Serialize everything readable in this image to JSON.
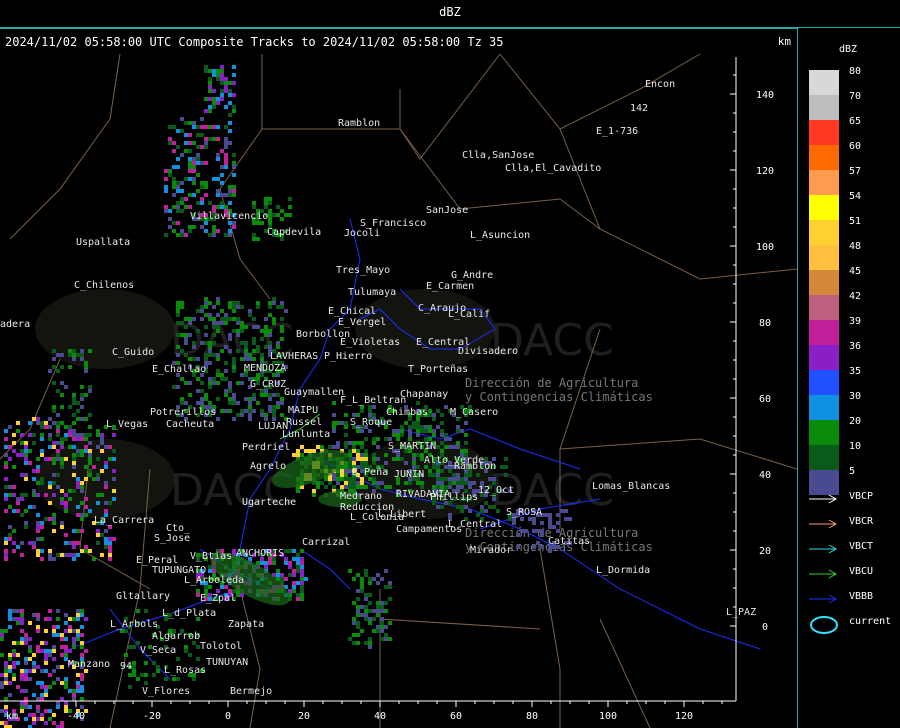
{
  "window": {
    "title": "dBZ"
  },
  "header": {
    "text": "2024/11/02 05:58:00 UTC Composite Tracks to 2024/11/02 05:58:00 Tz 35",
    "unit_top": "km"
  },
  "x_axis": {
    "unit": "km",
    "ticks": [
      "-40",
      "-20",
      "0",
      "20",
      "40",
      "60",
      "80",
      "100",
      "120"
    ]
  },
  "y_axis": {
    "ticks": [
      "140",
      "120",
      "100",
      "80",
      "60",
      "40",
      "20",
      "0"
    ]
  },
  "scale": {
    "unit": "dBZ",
    "levels": [
      {
        "label": "80",
        "color": "#d8d8d8"
      },
      {
        "label": "70",
        "color": "#bdbdbd"
      },
      {
        "label": "65",
        "color": "#ff3a20"
      },
      {
        "label": "60",
        "color": "#ff6a00"
      },
      {
        "label": "57",
        "color": "#ff9a50"
      },
      {
        "label": "54",
        "color": "#ffff00"
      },
      {
        "label": "51",
        "color": "#ffd030"
      },
      {
        "label": "48",
        "color": "#ffc040"
      },
      {
        "label": "45",
        "color": "#d4883a"
      },
      {
        "label": "42",
        "color": "#c06080"
      },
      {
        "label": "39",
        "color": "#c0209a"
      },
      {
        "label": "36",
        "color": "#8a1fc8"
      },
      {
        "label": "35",
        "color": "#2050ff"
      },
      {
        "label": "30",
        "color": "#1090e0"
      },
      {
        "label": "20",
        "color": "#0a8a0a"
      },
      {
        "label": "10",
        "color": "#0a5a1a"
      },
      {
        "label": "5",
        "color": "#4a4a90"
      }
    ]
  },
  "legend": [
    {
      "label": "VBCP",
      "color": "#ffffff"
    },
    {
      "label": "VBCR",
      "color": "#ff9a7a"
    },
    {
      "label": "VBCT",
      "color": "#30e0e0"
    },
    {
      "label": "VBCU",
      "color": "#30d030"
    },
    {
      "label": "VBBB",
      "color": "#2030ff"
    },
    {
      "label": "current",
      "color": "#30e0ff"
    }
  ],
  "places": [
    {
      "name": "Encon"
    },
    {
      "name": "142"
    },
    {
      "name": "E_1-736"
    },
    {
      "name": "Ramblon"
    },
    {
      "name": "Clla,SanJose"
    },
    {
      "name": "Clla,El_Cavadito"
    },
    {
      "name": "S_Francisco"
    },
    {
      "name": "Jocoli"
    },
    {
      "name": "SanJose"
    },
    {
      "name": "L_Asuncion"
    },
    {
      "name": "Uspallata"
    },
    {
      "name": "Capdevila"
    },
    {
      "name": "Villavicencio"
    },
    {
      "name": "Tres_Mayo"
    },
    {
      "name": "G_Andre"
    },
    {
      "name": "Tulumaya"
    },
    {
      "name": "E_Carmen"
    },
    {
      "name": "C_Chilenos"
    },
    {
      "name": "E_Chical"
    },
    {
      "name": "E_Vergel"
    },
    {
      "name": "C_Araujo"
    },
    {
      "name": "L_Calif"
    },
    {
      "name": "Borbollon"
    },
    {
      "name": "E_Violetas"
    },
    {
      "name": "E_Central"
    },
    {
      "name": "Divisadero"
    },
    {
      "name": "C_Guido"
    },
    {
      "name": "P_Hierro"
    },
    {
      "name": "LAVHERAS"
    },
    {
      "name": "T_Porteñas"
    },
    {
      "name": "E_Challao"
    },
    {
      "name": "MENDOZA"
    },
    {
      "name": "G_CRUZ"
    },
    {
      "name": "Guaymallen"
    },
    {
      "name": "F_L_Beltran"
    },
    {
      "name": "Chapanay"
    },
    {
      "name": "Potrerillos"
    },
    {
      "name": "MAIPU"
    },
    {
      "name": "Chimbas"
    },
    {
      "name": "M_Casero"
    },
    {
      "name": "L_Vegas"
    },
    {
      "name": "Cacheuta"
    },
    {
      "name": "Russel"
    },
    {
      "name": "LUJAN"
    },
    {
      "name": "Lunlunta"
    },
    {
      "name": "S_Roque"
    },
    {
      "name": "Perdriel"
    },
    {
      "name": "S_MARTIN"
    },
    {
      "name": "Alto_Verde"
    },
    {
      "name": "Ramblon"
    },
    {
      "name": "Agrelo"
    },
    {
      "name": "B_Peña"
    },
    {
      "name": "JUNIN"
    },
    {
      "name": "RIVADAVIA"
    },
    {
      "name": "12_Oct"
    },
    {
      "name": "Lomas_Blancas"
    },
    {
      "name": "Ugarteche"
    },
    {
      "name": "Medrano"
    },
    {
      "name": "Reduccion"
    },
    {
      "name": "Phillips"
    },
    {
      "name": "L_Colonia"
    },
    {
      "name": "L_Libert"
    },
    {
      "name": "S_ROSA"
    },
    {
      "name": "La_Carrera"
    },
    {
      "name": "L_Central"
    },
    {
      "name": "Campamentos"
    },
    {
      "name": "Cto_"
    },
    {
      "name": "S_Jose"
    },
    {
      "name": "Carrizal"
    },
    {
      "name": "Catitas"
    },
    {
      "name": "Mirador"
    },
    {
      "name": "E_Peral"
    },
    {
      "name": "V_Btias"
    },
    {
      "name": "ANCHORIS"
    },
    {
      "name": "TUPUNGATO"
    },
    {
      "name": "L_Dormida"
    },
    {
      "name": "L_Arboleda"
    },
    {
      "name": "Gltallary"
    },
    {
      "name": "E_Zpal"
    },
    {
      "name": "L_d_Plata"
    },
    {
      "name": "Zapata"
    },
    {
      "name": "L_PAZ"
    },
    {
      "name": "L_Arbols"
    },
    {
      "name": "Algarrob"
    },
    {
      "name": "V_Seca"
    },
    {
      "name": "Tolotol"
    },
    {
      "name": "Manzano"
    },
    {
      "name": "L_Rosas"
    },
    {
      "name": "TUNUYAN"
    },
    {
      "name": "V_Flores"
    },
    {
      "name": "Bermejo"
    },
    {
      "name": "adera"
    },
    {
      "name": "94"
    }
  ],
  "watermark": {
    "text": "DACC",
    "subtitle": "Dirección de Agricultura",
    "subtitle2": "y Contingencias Climáticas"
  }
}
